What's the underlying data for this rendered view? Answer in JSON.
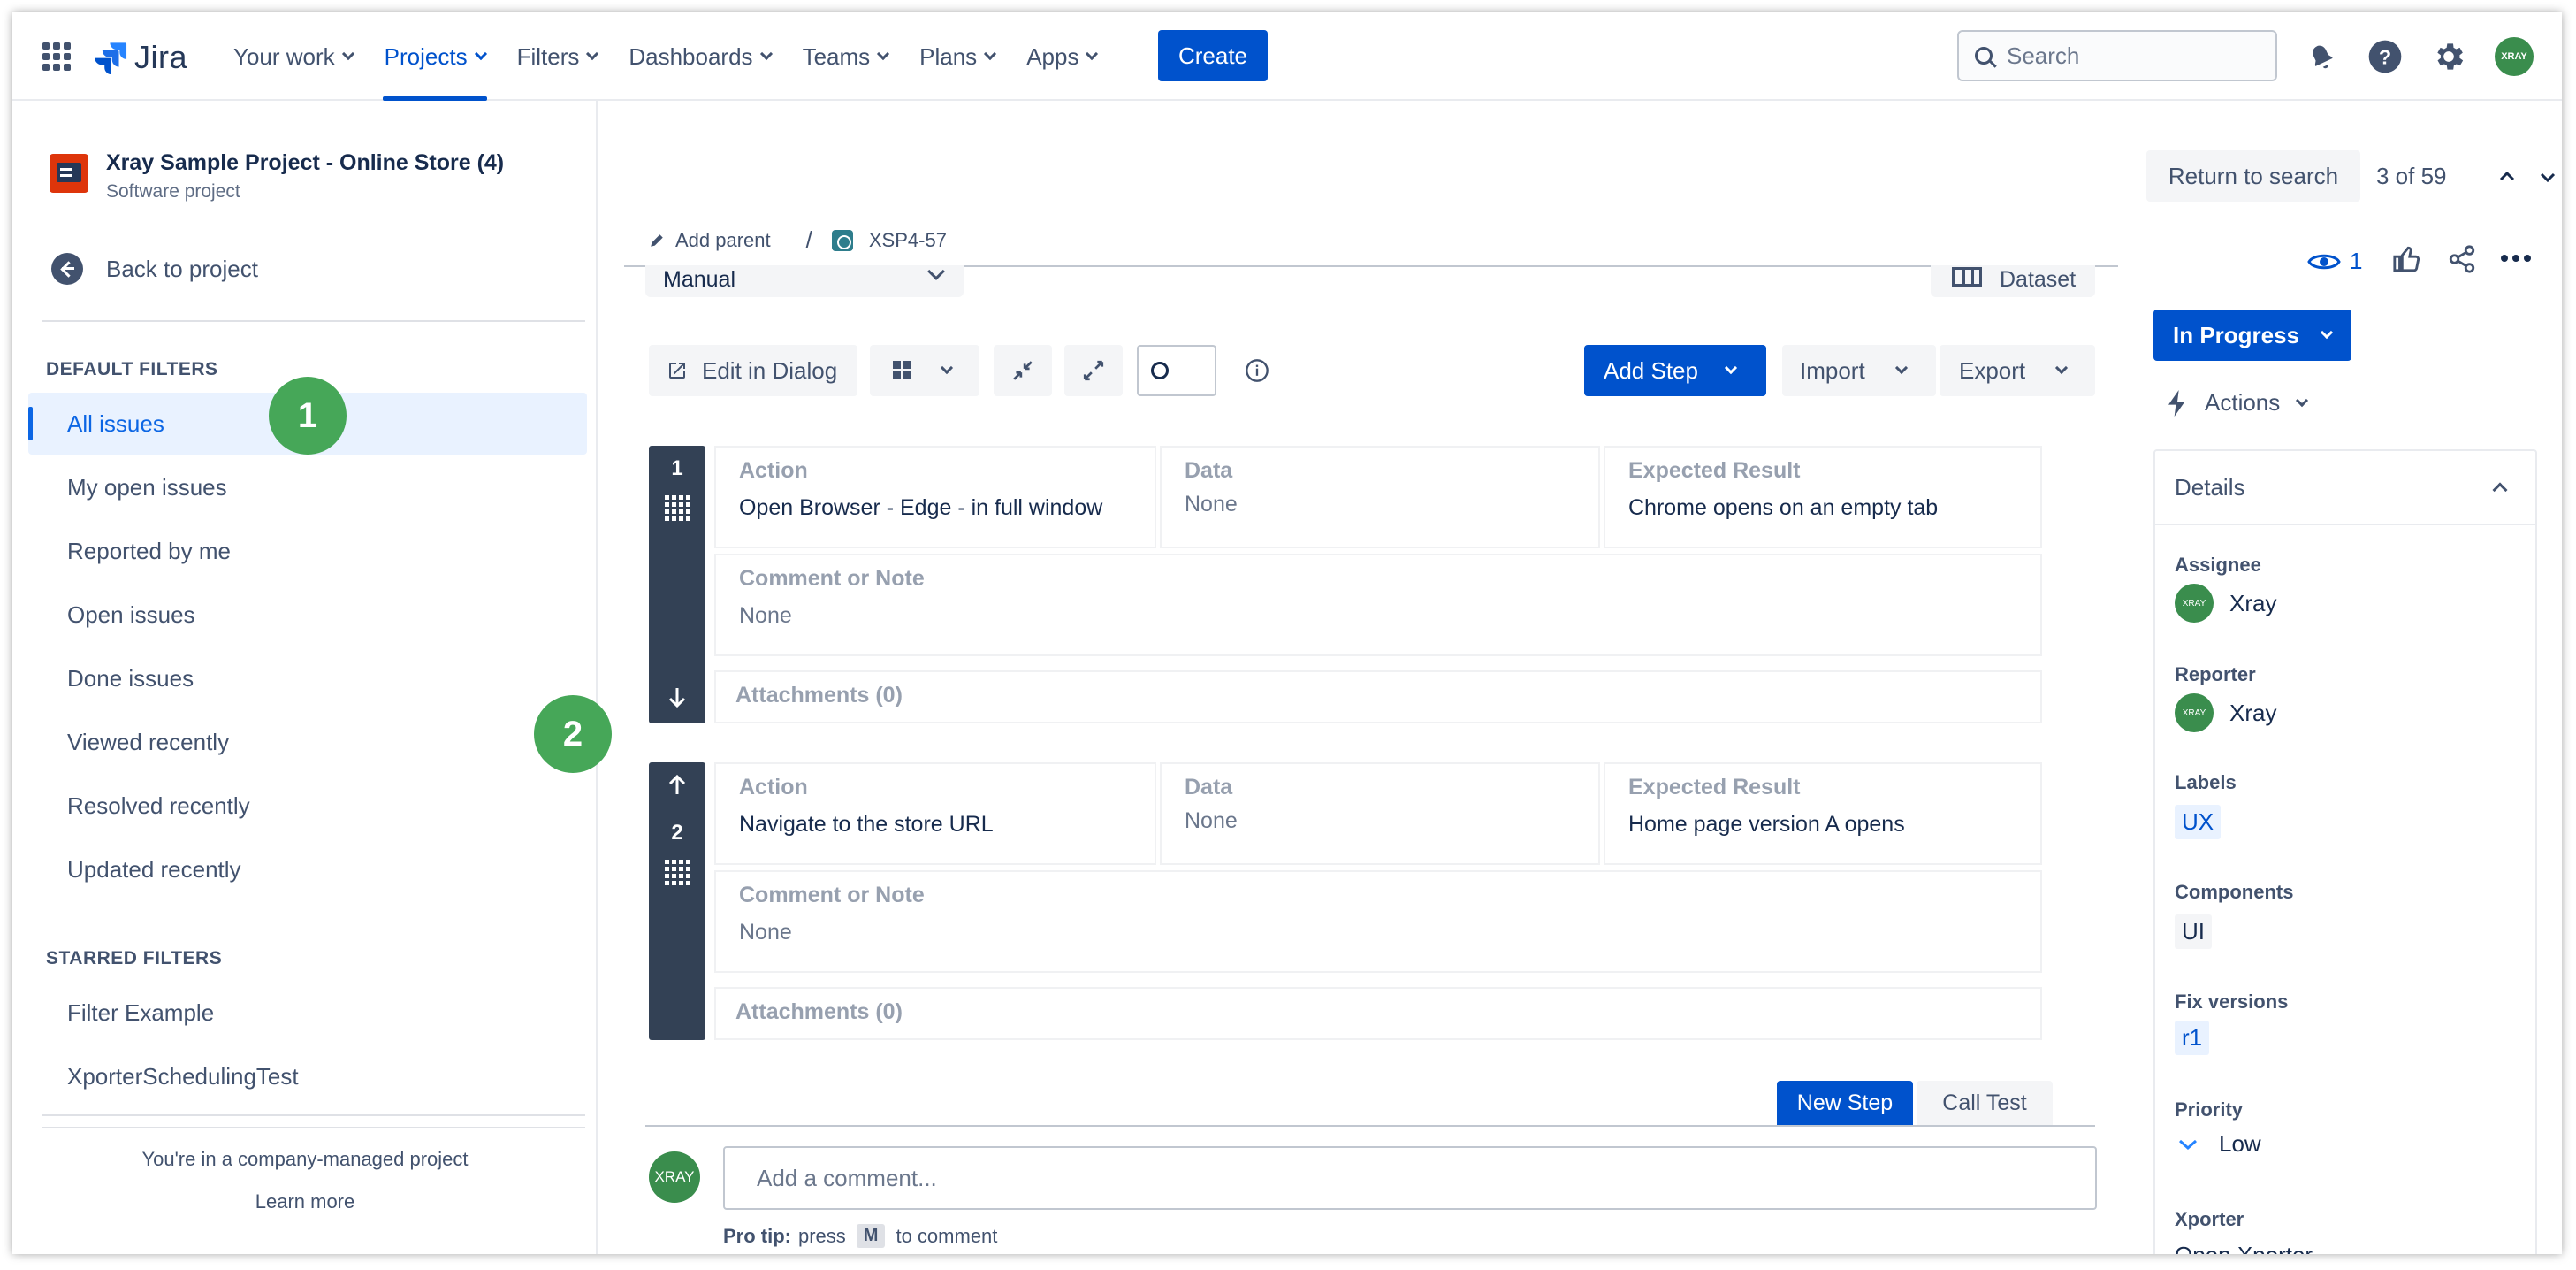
{
  "nav": {
    "product": "Jira",
    "items": [
      "Your work",
      "Projects",
      "Filters",
      "Dashboards",
      "Teams",
      "Plans",
      "Apps"
    ],
    "active": "Projects",
    "create_label": "Create",
    "search_placeholder": "Search",
    "avatar_text": "XRAY"
  },
  "sidebar": {
    "project_name": "Xray Sample Project - Online Store (4)",
    "project_type": "Software project",
    "back_label": "Back to project",
    "default_filters_title": "DEFAULT FILTERS",
    "default_filters": [
      "All issues",
      "My open issues",
      "Reported by me",
      "Open issues",
      "Done issues",
      "Viewed recently",
      "Resolved recently",
      "Updated recently"
    ],
    "starred_filters_title": "STARRED FILTERS",
    "starred_filters": [
      "Filter Example",
      "XporterSchedulingTest"
    ],
    "footer_text": "You're in a company-managed project",
    "learn_more": "Learn more"
  },
  "annotations": [
    "1",
    "2"
  ],
  "main": {
    "add_parent": "Add parent",
    "breadcrumb_sep": "/",
    "issue_key": "XSP4-57",
    "test_type": "Manual",
    "dataset_label": "Dataset",
    "toolbar": {
      "edit_in_dialog": "Edit in Dialog",
      "add_step": "Add Step",
      "import": "Import",
      "export": "Export"
    },
    "headers": {
      "action": "Action",
      "data": "Data",
      "expected": "Expected Result",
      "comment": "Comment or Note"
    },
    "steps": [
      {
        "num": "1",
        "action": "Open Browser - Edge - in full window",
        "data": "None",
        "expected": "Chrome opens on an empty tab",
        "comment": "None",
        "attachments": "Attachments (0)"
      },
      {
        "num": "2",
        "action": "Navigate to the store URL",
        "data": "None",
        "expected": "Home page version A opens",
        "comment": "None",
        "attachments": "Attachments (0)"
      }
    ],
    "new_step": "New Step",
    "call_test": "Call Test",
    "comment_placeholder": "Add a comment...",
    "protip_prefix": "Pro tip:",
    "protip_press": "press",
    "protip_key": "M",
    "protip_suffix": "to comment"
  },
  "right": {
    "return_to_search": "Return to search",
    "position": "3 of 59",
    "watchers": "1",
    "status": "In Progress",
    "actions": "Actions",
    "details_title": "Details",
    "fields": {
      "assignee_label": "Assignee",
      "assignee": "Xray",
      "reporter_label": "Reporter",
      "reporter": "Xray",
      "labels_label": "Labels",
      "labels": "UX",
      "components_label": "Components",
      "components": "UI",
      "fix_versions_label": "Fix versions",
      "fix_versions": "r1",
      "priority_label": "Priority",
      "priority": "Low",
      "xporter_label": "Xporter",
      "xporter": "Open Xporter"
    }
  },
  "colors": {
    "primary": "#0052cc",
    "annotation": "#46a758",
    "step_bar": "#334155"
  }
}
